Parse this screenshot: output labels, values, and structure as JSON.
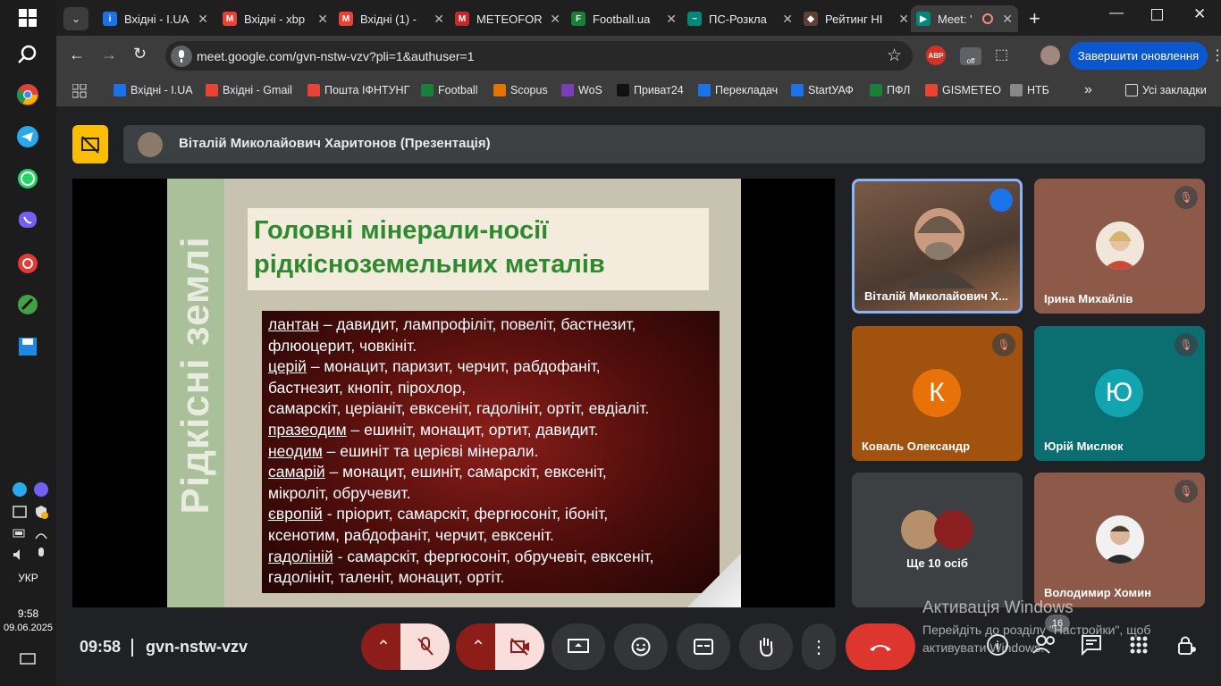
{
  "taskbar": {
    "lang": "УКР",
    "time": "9:58",
    "date": "09.06.2025"
  },
  "tabs": [
    {
      "label": "Вхідні - I.UA",
      "favicon": "i-ua-icon"
    },
    {
      "label": "Вхідні - xbp",
      "favicon": "gmail-icon"
    },
    {
      "label": "Вхідні (1) -",
      "favicon": "gmail-icon"
    },
    {
      "label": "METEOFOR",
      "favicon": "meteofor-icon"
    },
    {
      "label": "Football.ua",
      "favicon": "football-icon"
    },
    {
      "label": "ПС-Розкла",
      "favicon": "ps-icon"
    },
    {
      "label": "Рейтинг НІ",
      "favicon": "shield-icon"
    },
    {
      "label": "Meet: '",
      "favicon": "meet-icon"
    }
  ],
  "omnibar": {
    "url": "meet.google.com/gvn-nstw-vzv?pli=1&authuser=1",
    "update_label": "Завершити оновлення"
  },
  "bookmarks": [
    {
      "label": "Вхідні - I.UA",
      "color": "#1a73e8"
    },
    {
      "label": "Вхідні - Gmail",
      "color": "#ea4335"
    },
    {
      "label": "Пошта ІФНТУНГ",
      "color": "#ea4335"
    },
    {
      "label": "Football",
      "color": "#188038"
    },
    {
      "label": "Scopus",
      "color": "#e37400"
    },
    {
      "label": "WoS",
      "color": "#7b3fb5"
    },
    {
      "label": "Приват24",
      "color": "#111111"
    },
    {
      "label": "Перекладач",
      "color": "#1a73e8"
    },
    {
      "label": "StartУАФ",
      "color": "#1a73e8"
    },
    {
      "label": "ПФЛ",
      "color": "#188038"
    },
    {
      "label": "GISMETEO",
      "color": "#ea4335"
    },
    {
      "label": "НТБ",
      "color": "#888888"
    }
  ],
  "bookmarks_all": "Усі закладки",
  "presenter": {
    "title": "Віталій Миколайович Харитонов (Презентація)"
  },
  "slide": {
    "vertical": "Рідкісні землі",
    "title_line1": "Головні мінерали-носії",
    "title_line2": "рідкісноземельних металів",
    "lines": [
      {
        "u": "лантан",
        "t": " – давидит, лампрофіліт, повеліт, бастнезит,"
      },
      {
        "u": "",
        "t": "флюоцерит, човкініт."
      },
      {
        "u": "церій",
        "t": " – монацит, паризит, черчит, рабдофаніт,"
      },
      {
        "u": "",
        "t": "бастнезит, кнопіт, пірохлор,"
      },
      {
        "u": "",
        "t": "самарскіт, церіаніт, евксеніт, гадолініт, ортіт, евдіаліт."
      },
      {
        "u": "празеодим",
        "t": " – ешиніт, монацит, ортит, давидит."
      },
      {
        "u": "неодим",
        "t": " – ешиніт та церієві мінерали."
      },
      {
        "u": "самарій",
        "t": " – монацит, ешиніт, самарскіт, евксеніт,"
      },
      {
        "u": "",
        "t": "мікроліт, обручевит."
      },
      {
        "u": "європій",
        "t": " - пріорит, самарскіт, фергюсоніт, ібоніт,"
      },
      {
        "u": "",
        "t": "ксенотим, рабдофаніт, черчит, евксеніт."
      },
      {
        "u": "гадоліній",
        "t": " - самарскіт, фергюсоніт, обручевіт, евксеніт,"
      },
      {
        "u": "",
        "t": "гадолініт, таленіт, монацит, ортіт."
      }
    ]
  },
  "participants": {
    "p1": "Віталій Миколайович Х...",
    "p2": "Ірина Михайлів",
    "p3": "Коваль Олександр",
    "p3_letter": "К",
    "p4": "Юрій Мислюк",
    "p4_letter": "Ю",
    "p5": "Ще 10 осіб",
    "p6": "Володимир Хомин"
  },
  "bottom": {
    "time": "09:58",
    "code": "gvn-nstw-vzv",
    "people_count": "16"
  },
  "watermark": {
    "line1": "Активація Windows",
    "line2": "Перейдіть до розділу \"Настройки\", щоб активувати Windows."
  }
}
